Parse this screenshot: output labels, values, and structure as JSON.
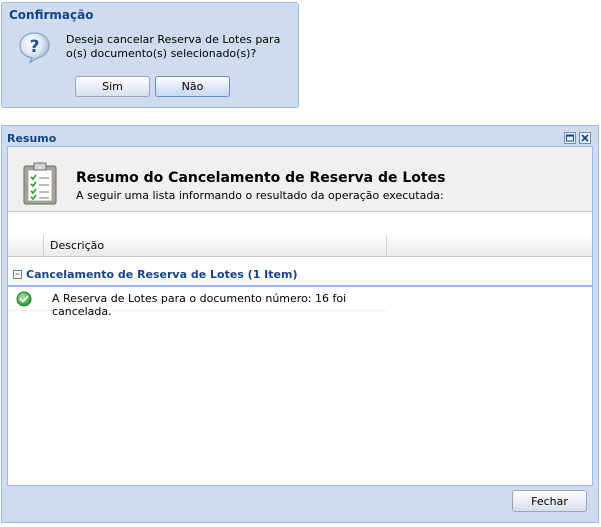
{
  "confirm_dialog": {
    "title": "Confirmação",
    "message": "Deseja cancelar Reserva de Lotes para o(s) documento(s) selecionado(s)?",
    "yes_label": "Sim",
    "no_label": "Não",
    "icon": "question-icon"
  },
  "resumo_window": {
    "title": "Resumo",
    "header": {
      "heading": "Resumo do Cancelamento de Reserva de Lotes",
      "subtitle": "A seguir uma lista informando o resultado da operação executada:",
      "icon": "clipboard-checklist-icon"
    },
    "grid": {
      "columns": [
        "",
        "Descrição"
      ],
      "group_label": "Cancelamento de Reserva de Lotes (1 Item)",
      "rows": [
        {
          "status_icon": "success-check-icon",
          "text": "A Reserva de Lotes para o documento número: 16 foi cancelada."
        }
      ]
    },
    "close_label": "Fechar"
  },
  "colors": {
    "title_blue": "#15428b",
    "frame_blue": "#cfdcef",
    "border_blue": "#99bbe8",
    "success_green": "#3aa53a"
  }
}
